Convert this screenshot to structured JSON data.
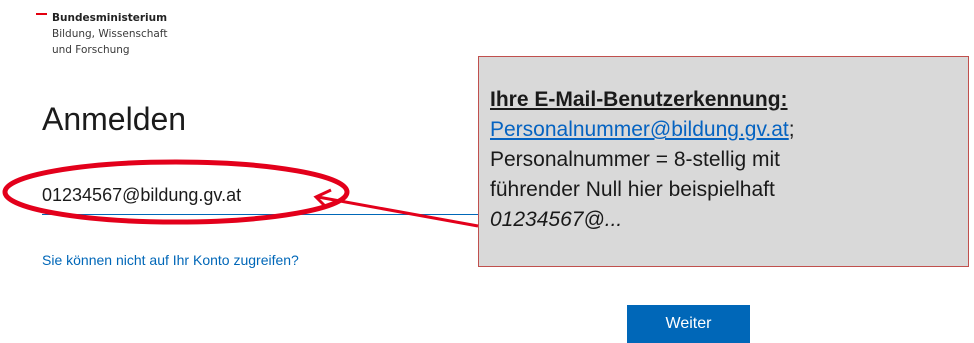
{
  "logo": {
    "line1": "Bundesministerium",
    "line2": "Bildung, Wissenschaft",
    "line3": "und Forschung"
  },
  "page": {
    "title": "Anmelden"
  },
  "email_input": {
    "value": "01234567@bildung.gv.at"
  },
  "links": {
    "cant_access": "Sie können nicht auf Ihr Konto zugreifen?"
  },
  "buttons": {
    "next": "Weiter"
  },
  "callout": {
    "heading": "Ihre E-Mail-Benutzerkennung:",
    "link_text": "Personalnummer@bildung.gv.at",
    "link_suffix": ";",
    "line2": "Personalnummer =  8-stellig mit",
    "line3": "führender Null  hier beispielhaft",
    "line4": "01234567@..."
  },
  "colors": {
    "accent": "#0067b8",
    "annotation_red": "#e3001b",
    "callout_bg": "#d9d9d9",
    "callout_border": "#c0504d",
    "flag_red": "#e3000f"
  },
  "icons": {
    "logo_flag": "austria-flag-icon"
  }
}
